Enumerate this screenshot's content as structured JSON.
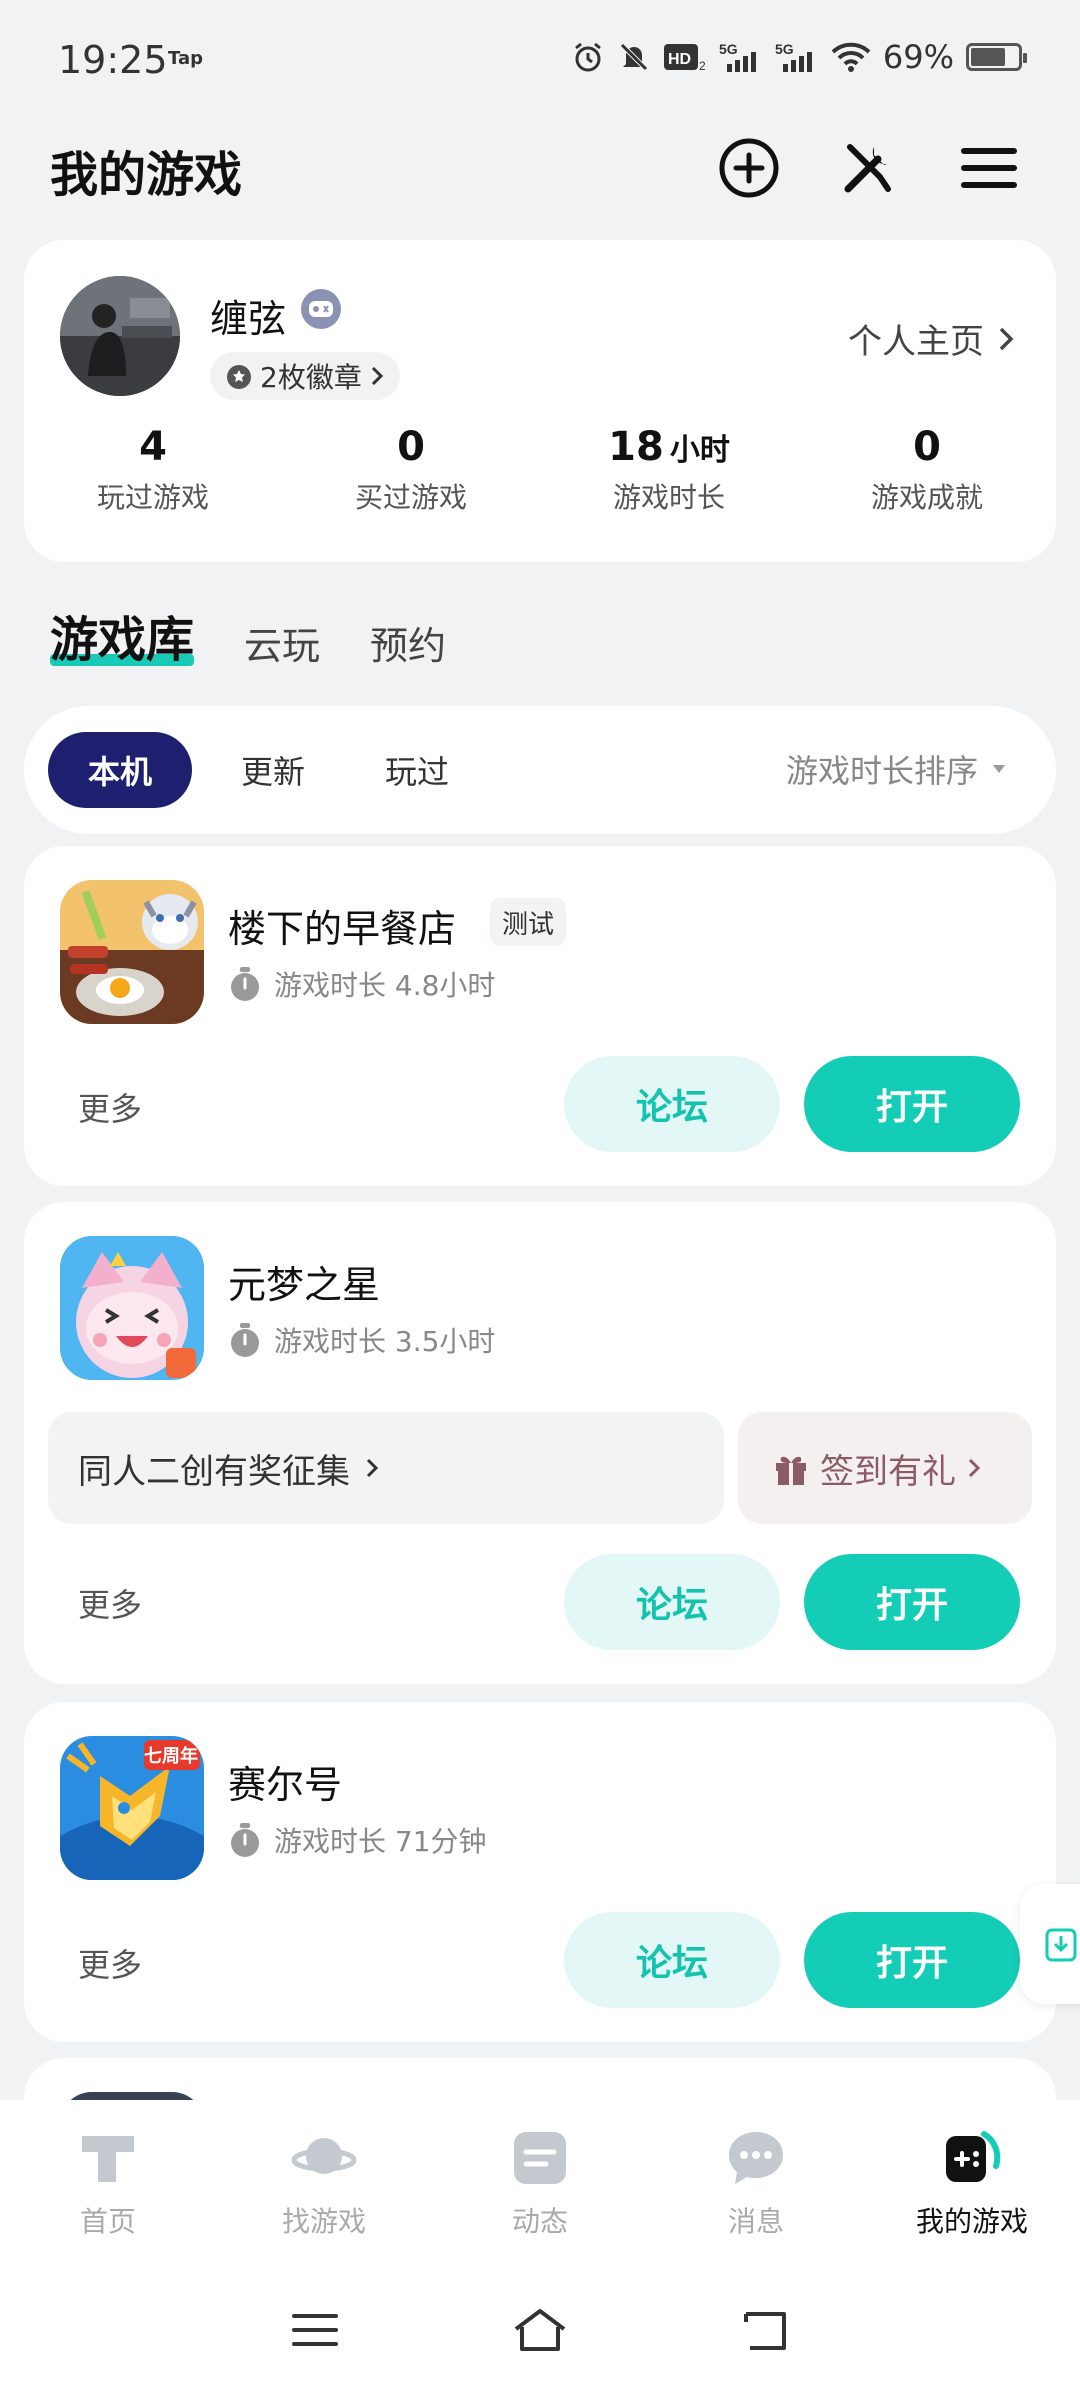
{
  "status_bar": {
    "time": "19:25",
    "tap_label": "Tap",
    "battery": "69%",
    "icons": [
      "alarm-icon",
      "mute-icon",
      "hd-icon",
      "signal-5g-icon",
      "signal-5g-icon",
      "wifi-icon",
      "battery-icon"
    ]
  },
  "header": {
    "title": "我的游戏",
    "icons": [
      "add-circle-icon",
      "tools-icon",
      "menu-icon"
    ]
  },
  "profile": {
    "username": "缠弦",
    "badge_count": "2枚徽章",
    "home_link": "个人主页",
    "stats": [
      {
        "value": "4",
        "unit": "",
        "label": "玩过游戏"
      },
      {
        "value": "0",
        "unit": "",
        "label": "买过游戏"
      },
      {
        "value": "18",
        "unit": "小时",
        "label": "游戏时长"
      },
      {
        "value": "0",
        "unit": "",
        "label": "游戏成就"
      }
    ]
  },
  "section_tabs": [
    "游戏库",
    "云玩",
    "预约"
  ],
  "filter": {
    "chips": [
      "本机",
      "更新",
      "玩过"
    ],
    "sort": "游戏时长排序"
  },
  "games": [
    {
      "name": "楼下的早餐店",
      "tag": "测试",
      "playtime": "游戏时长 4.8小时",
      "more": "更多",
      "forum": "论坛",
      "open": "打开"
    },
    {
      "name": "元梦之星",
      "playtime": "游戏时长 3.5小时",
      "promo_left": "同人二创有奖征集",
      "promo_right": "签到有礼",
      "more": "更多",
      "forum": "论坛",
      "open": "打开"
    },
    {
      "name": "赛尔号",
      "icon_text": "七周年",
      "playtime": "游戏时长 71分钟",
      "more": "更多",
      "forum": "论坛",
      "open": "打开"
    }
  ],
  "bottom_nav": [
    {
      "label": "首页",
      "icon": "home-tap-icon"
    },
    {
      "label": "找游戏",
      "icon": "planet-icon"
    },
    {
      "label": "动态",
      "icon": "feed-icon"
    },
    {
      "label": "消息",
      "icon": "chat-icon"
    },
    {
      "label": "我的游戏",
      "icon": "gamepad-icon"
    }
  ],
  "colors": {
    "accent": "#14cdb7",
    "chip_active": "#1f1f6f",
    "background": "#f1f2f4"
  }
}
